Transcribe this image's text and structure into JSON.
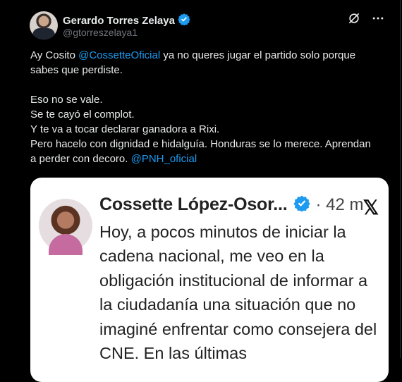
{
  "tweet": {
    "author_name": "Gerardo Torres Zelaya",
    "author_handle": "@gtorreszelaya1",
    "text_part1": "Ay Cosito ",
    "mention1": "@CossetteOficial",
    "text_part2": " ya no queres jugar el partido solo porque sabes que perdiste.\n\nEso no se vale.\nSe te cayó el complot.\nY te va a tocar declarar ganadora a Rixi.\nPero hacelo con dignidad e hidalguía. Honduras se lo merece. Aprendan a perder con decoro. ",
    "mention2": "@PNH_oficial"
  },
  "embedded": {
    "author_name": "Cossette López-Osor...",
    "time": "· 42 m",
    "x_logo": "𝕏",
    "text": "Hoy, a pocos minutos de iniciar la cadena nacional, me veo en la obligación institucional de informar a la ciudadanía una situación que no imaginé enfrentar como consejera del CNE. En las últimas"
  },
  "icons": [
    "verified-icon",
    "grok-icon",
    "more-icon"
  ],
  "colors": {
    "accent": "#1d9bf0",
    "muted": "#71767b",
    "text": "#e7e9ea",
    "background": "#000000"
  }
}
